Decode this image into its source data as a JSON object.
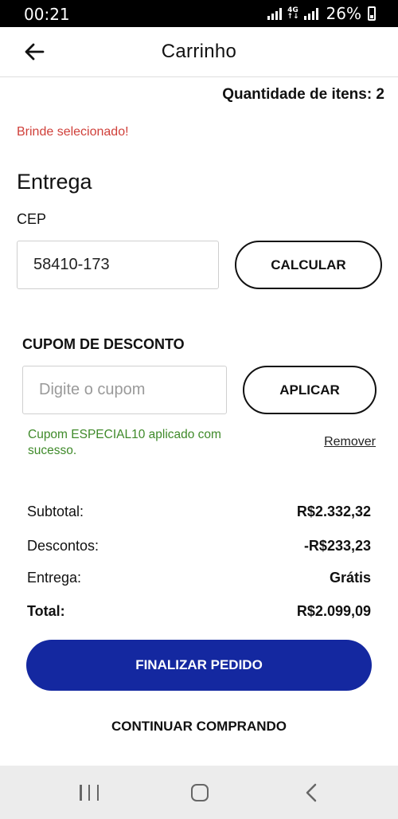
{
  "status_bar": {
    "time": "00:21",
    "network": "4G",
    "battery": "26%"
  },
  "header": {
    "title": "Carrinho",
    "back_icon": "arrow-left-icon"
  },
  "cart": {
    "quantity_text": "Quantidade de itens: 2",
    "gift_message": "Brinde selecionado!"
  },
  "delivery": {
    "heading": "Entrega",
    "cep_label": "CEP",
    "cep_value": "58410-173",
    "calculate_label": "CALCULAR"
  },
  "coupon": {
    "label": "CUPOM DE DESCONTO",
    "placeholder": "Digite o cupom",
    "apply_label": "APLICAR",
    "success_message": "Cupom ESPECIAL10 aplicado com sucesso.",
    "remove_label": "Remover"
  },
  "summary": {
    "subtotal_label": "Subtotal:",
    "subtotal_value": "R$2.332,32",
    "discount_label": "Descontos:",
    "discount_value": "-R$233,23",
    "delivery_label": "Entrega:",
    "delivery_value": "Grátis",
    "total_label": "Total:",
    "total_value": "R$2.099,09"
  },
  "actions": {
    "finalize_label": "FINALIZAR PEDIDO",
    "continue_label": "CONTINUAR COMPRANDO"
  },
  "colors": {
    "primary": "#1428a0",
    "success": "#3f8a2a",
    "alert": "#d0403a"
  }
}
